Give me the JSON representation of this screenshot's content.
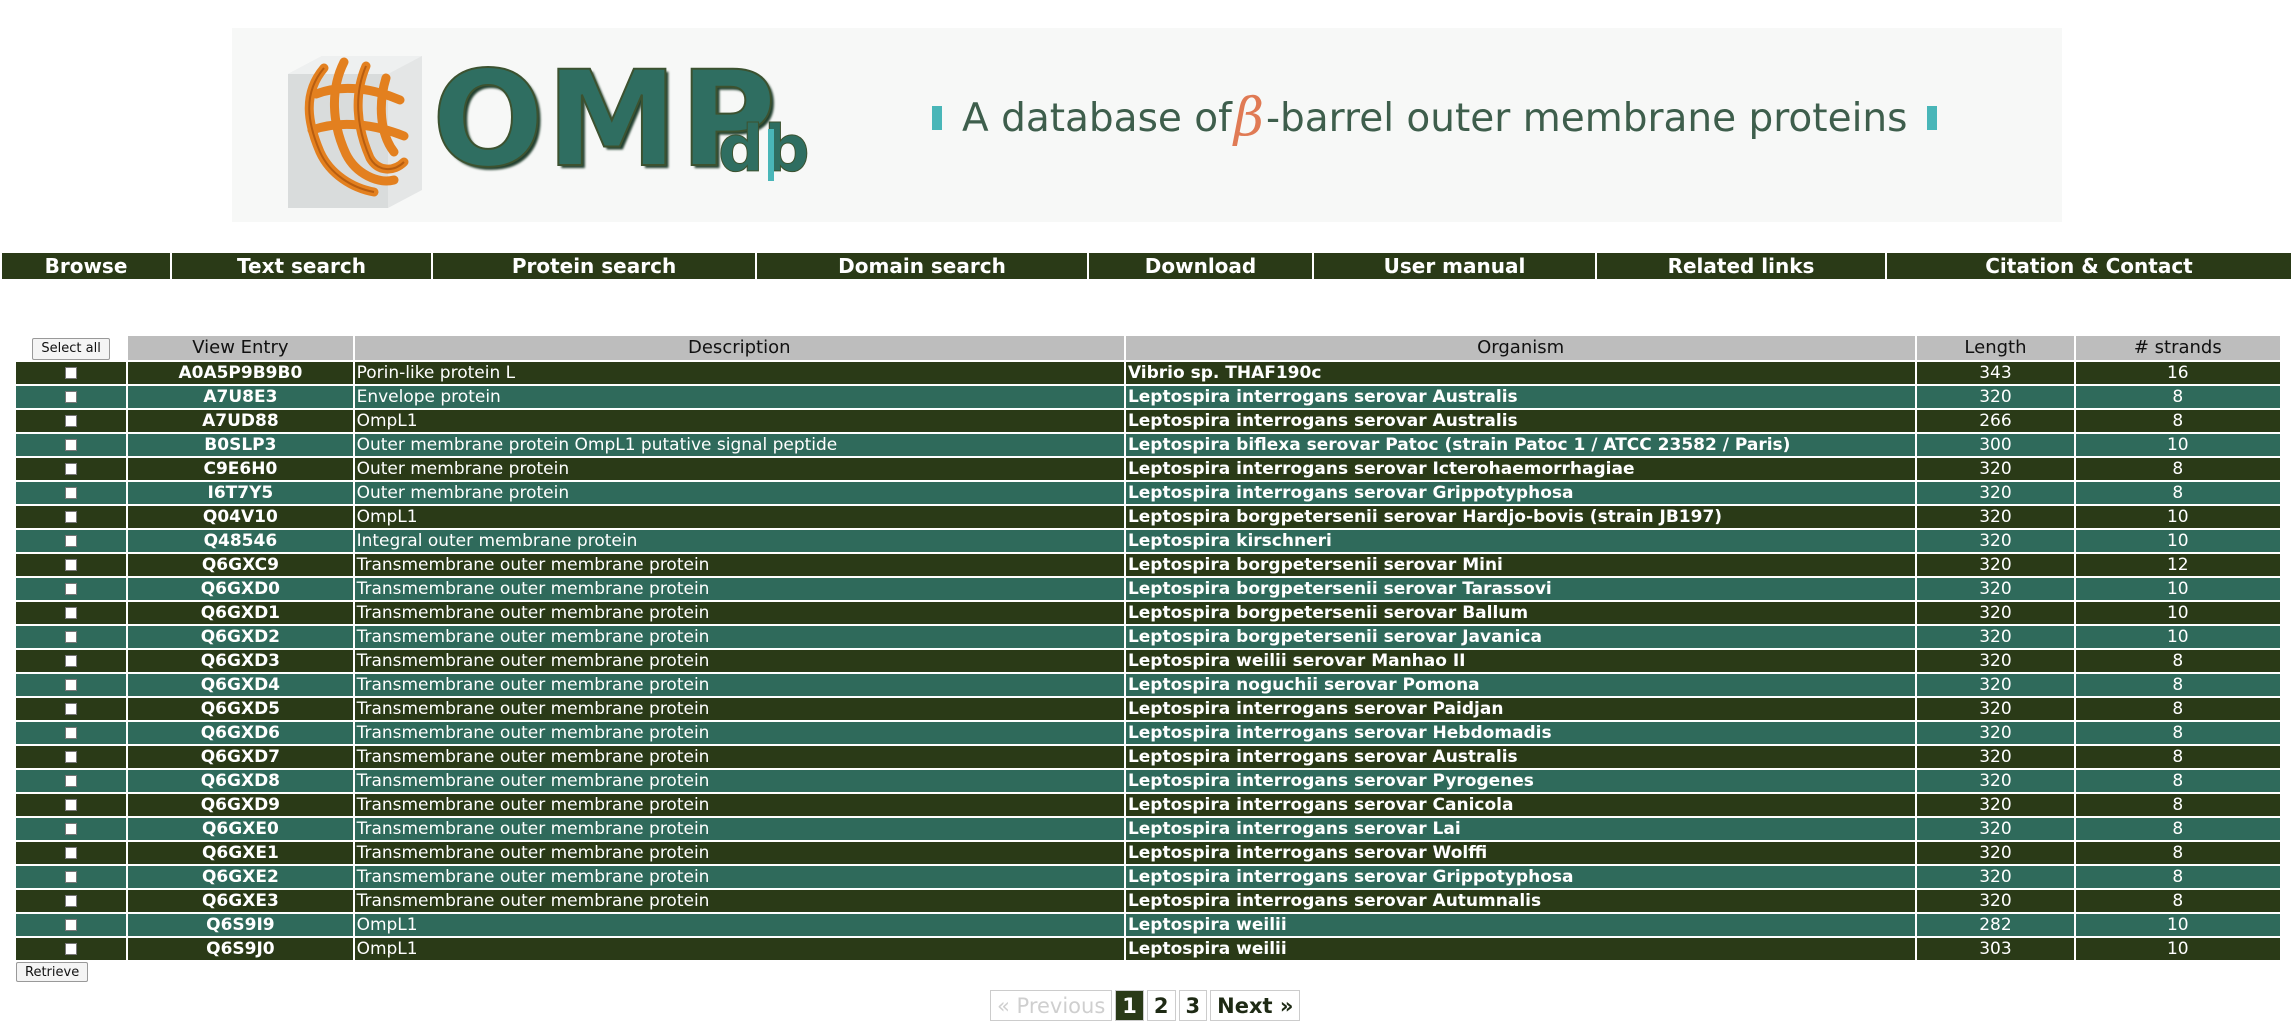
{
  "banner": {
    "logo_text": "OMP",
    "logo_sub": "db",
    "tagline_before": "A database of",
    "tagline_beta": "β",
    "tagline_after": "-barrel outer membrane proteins"
  },
  "nav": [
    {
      "label": "Browse",
      "width": 168
    },
    {
      "label": "Text search",
      "width": 259
    },
    {
      "label": "Protein search",
      "width": 322
    },
    {
      "label": "Domain search",
      "width": 330
    },
    {
      "label": "Download",
      "width": 223
    },
    {
      "label": "User manual",
      "width": 281
    },
    {
      "label": "Related links",
      "width": 288
    },
    {
      "label": "Citation & Contact",
      "width": 404
    }
  ],
  "table": {
    "select_all_label": "Select all",
    "headers": {
      "entry": "View Entry",
      "description": "Description",
      "organism": "Organism",
      "length": "Length",
      "strands": "# strands"
    },
    "rows": [
      {
        "entry": "A0A5P9B9B0",
        "description": "Porin-like protein L",
        "organism": "Vibrio sp. THAF190c",
        "length": "343",
        "strands": "16"
      },
      {
        "entry": "A7U8E3",
        "description": "Envelope protein",
        "organism": "Leptospira interrogans serovar Australis",
        "length": "320",
        "strands": "8"
      },
      {
        "entry": "A7UD88",
        "description": "OmpL1",
        "organism": "Leptospira interrogans serovar Australis",
        "length": "266",
        "strands": "8"
      },
      {
        "entry": "B0SLP3",
        "description": "Outer membrane protein OmpL1 putative signal peptide",
        "organism": "Leptospira biflexa serovar Patoc (strain Patoc 1 / ATCC 23582 / Paris)",
        "length": "300",
        "strands": "10"
      },
      {
        "entry": "C9E6H0",
        "description": "Outer membrane protein",
        "organism": "Leptospira interrogans serovar Icterohaemorrhagiae",
        "length": "320",
        "strands": "8"
      },
      {
        "entry": "I6T7Y5",
        "description": "Outer membrane protein",
        "organism": "Leptospira interrogans serovar Grippotyphosa",
        "length": "320",
        "strands": "8"
      },
      {
        "entry": "Q04V10",
        "description": "OmpL1",
        "organism": "Leptospira borgpetersenii serovar Hardjo-bovis (strain JB197)",
        "length": "320",
        "strands": "10"
      },
      {
        "entry": "Q48546",
        "description": "Integral outer membrane protein",
        "organism": "Leptospira kirschneri",
        "length": "320",
        "strands": "10"
      },
      {
        "entry": "Q6GXC9",
        "description": "Transmembrane outer membrane protein",
        "organism": "Leptospira borgpetersenii serovar Mini",
        "length": "320",
        "strands": "12"
      },
      {
        "entry": "Q6GXD0",
        "description": "Transmembrane outer membrane protein",
        "organism": "Leptospira borgpetersenii serovar Tarassovi",
        "length": "320",
        "strands": "10"
      },
      {
        "entry": "Q6GXD1",
        "description": "Transmembrane outer membrane protein",
        "organism": "Leptospira borgpetersenii serovar Ballum",
        "length": "320",
        "strands": "10"
      },
      {
        "entry": "Q6GXD2",
        "description": "Transmembrane outer membrane protein",
        "organism": "Leptospira borgpetersenii serovar Javanica",
        "length": "320",
        "strands": "10"
      },
      {
        "entry": "Q6GXD3",
        "description": "Transmembrane outer membrane protein",
        "organism": "Leptospira weilii serovar Manhao II",
        "length": "320",
        "strands": "8"
      },
      {
        "entry": "Q6GXD4",
        "description": "Transmembrane outer membrane protein",
        "organism": "Leptospira noguchii serovar Pomona",
        "length": "320",
        "strands": "8"
      },
      {
        "entry": "Q6GXD5",
        "description": "Transmembrane outer membrane protein",
        "organism": "Leptospira interrogans serovar Paidjan",
        "length": "320",
        "strands": "8"
      },
      {
        "entry": "Q6GXD6",
        "description": "Transmembrane outer membrane protein",
        "organism": "Leptospira interrogans serovar Hebdomadis",
        "length": "320",
        "strands": "8"
      },
      {
        "entry": "Q6GXD7",
        "description": "Transmembrane outer membrane protein",
        "organism": "Leptospira interrogans serovar Australis",
        "length": "320",
        "strands": "8"
      },
      {
        "entry": "Q6GXD8",
        "description": "Transmembrane outer membrane protein",
        "organism": "Leptospira interrogans serovar Pyrogenes",
        "length": "320",
        "strands": "8"
      },
      {
        "entry": "Q6GXD9",
        "description": "Transmembrane outer membrane protein",
        "organism": "Leptospira interrogans serovar Canicola",
        "length": "320",
        "strands": "8"
      },
      {
        "entry": "Q6GXE0",
        "description": "Transmembrane outer membrane protein",
        "organism": "Leptospira interrogans serovar Lai",
        "length": "320",
        "strands": "8"
      },
      {
        "entry": "Q6GXE1",
        "description": "Transmembrane outer membrane protein",
        "organism": "Leptospira interrogans serovar Wolffi",
        "length": "320",
        "strands": "8"
      },
      {
        "entry": "Q6GXE2",
        "description": "Transmembrane outer membrane protein",
        "organism": "Leptospira interrogans serovar Grippotyphosa",
        "length": "320",
        "strands": "8"
      },
      {
        "entry": "Q6GXE3",
        "description": "Transmembrane outer membrane protein",
        "organism": "Leptospira interrogans serovar Autumnalis",
        "length": "320",
        "strands": "8"
      },
      {
        "entry": "Q6S9I9",
        "description": "OmpL1",
        "organism": "Leptospira weilii",
        "length": "282",
        "strands": "10"
      },
      {
        "entry": "Q6S9J0",
        "description": "OmpL1",
        "organism": "Leptospira weilii",
        "length": "303",
        "strands": "10"
      }
    ]
  },
  "retrieve_label": "Retrieve",
  "pagination": {
    "previous": "« Previous",
    "pages": [
      "1",
      "2",
      "3"
    ],
    "current": "1",
    "next": "Next »"
  },
  "colors": {
    "dark_green": "#2a3a17",
    "teal_green": "#2f6a5b",
    "logo_green": "#2f6e61",
    "accent_cyan": "#49b6b8",
    "beta_orange": "#e07a54"
  }
}
